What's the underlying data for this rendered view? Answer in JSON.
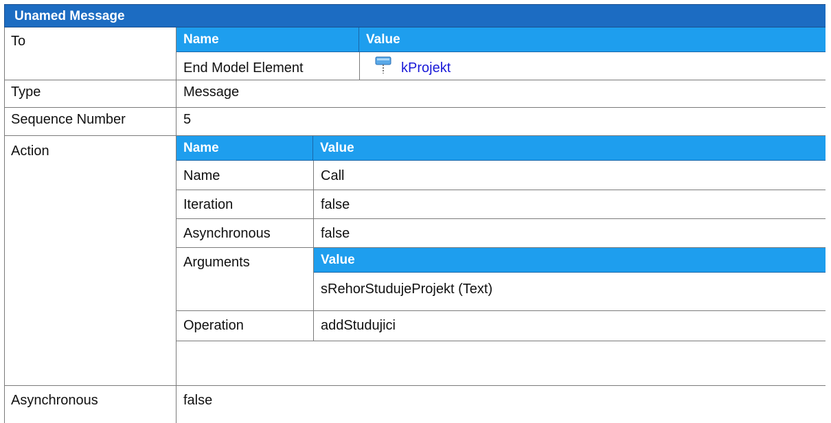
{
  "title": "Unamed Message",
  "rows": {
    "to": {
      "label": "To",
      "header": {
        "name": "Name",
        "value": "Value"
      },
      "item": {
        "name": "End Model Element",
        "value": "kProjekt",
        "icon": "class-element-icon"
      }
    },
    "type": {
      "label": "Type",
      "value": "Message"
    },
    "sequence": {
      "label": "Sequence Number",
      "value": "5"
    },
    "action": {
      "label": "Action",
      "header": {
        "name": "Name",
        "value": "Value"
      },
      "items": {
        "name": {
          "label": "Name",
          "value": "Call"
        },
        "iteration": {
          "label": "Iteration",
          "value": "false"
        },
        "asynchronous": {
          "label": "Asynchronous",
          "value": "false"
        },
        "arguments": {
          "label": "Arguments",
          "header": "Value",
          "value": "sRehorStudujeProjekt (Text)"
        },
        "operation": {
          "label": "Operation",
          "value": "addStudujici"
        }
      }
    },
    "asynchronous": {
      "label": "Asynchronous",
      "value": "false"
    }
  },
  "colors": {
    "title_bar": "#1c6cc2",
    "sub_header": "#1e9eee",
    "link": "#1a1ad8"
  }
}
